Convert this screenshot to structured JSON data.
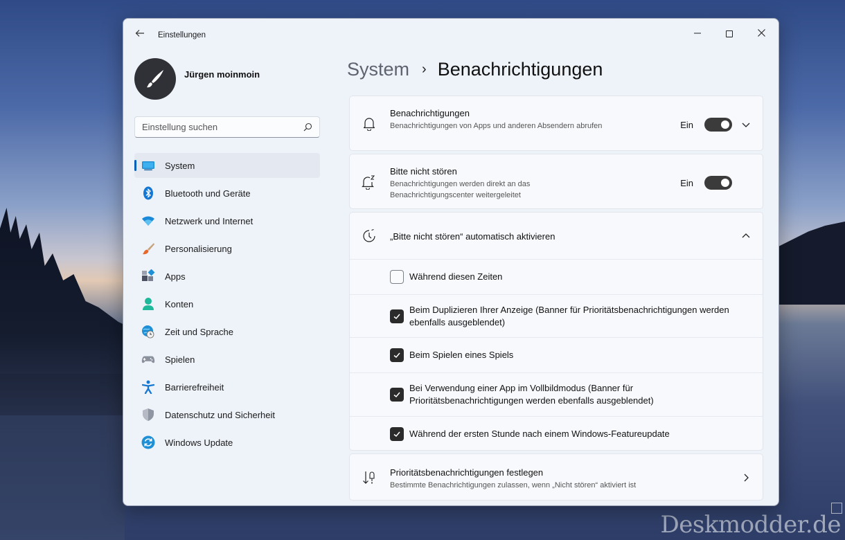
{
  "window": {
    "app_title": "Einstellungen"
  },
  "user": {
    "name": "Jürgen moinmoin"
  },
  "search": {
    "placeholder": "Einstellung suchen"
  },
  "sidebar": {
    "items": [
      {
        "label": "System",
        "icon": "system-icon",
        "active": true
      },
      {
        "label": "Bluetooth und Geräte",
        "icon": "bluetooth-icon"
      },
      {
        "label": "Netzwerk und Internet",
        "icon": "wifi-icon"
      },
      {
        "label": "Personalisierung",
        "icon": "brush-icon"
      },
      {
        "label": "Apps",
        "icon": "apps-icon"
      },
      {
        "label": "Konten",
        "icon": "person-icon"
      },
      {
        "label": "Zeit und Sprache",
        "icon": "clock-globe-icon"
      },
      {
        "label": "Spielen",
        "icon": "gamepad-icon"
      },
      {
        "label": "Barrierefreiheit",
        "icon": "accessibility-icon"
      },
      {
        "label": "Datenschutz und Sicherheit",
        "icon": "shield-icon"
      },
      {
        "label": "Windows Update",
        "icon": "update-icon"
      }
    ]
  },
  "breadcrumb": {
    "parent": "System",
    "separator": "›",
    "current": "Benachrichtigungen"
  },
  "notifications": {
    "title": "Benachrichtigungen",
    "description": "Benachrichtigungen von Apps und anderen Absendern abrufen",
    "toggle_label": "Ein",
    "enabled": true
  },
  "dnd": {
    "title": "Bitte nicht stören",
    "description": "Benachrichtigungen werden direkt an das Benachrichtigungscenter weitergeleitet",
    "toggle_label": "Ein",
    "enabled": true
  },
  "auto_dnd": {
    "title": "„Bitte nicht stören“ automatisch aktivieren",
    "expanded": true,
    "options": [
      {
        "label": "Während diesen Zeiten",
        "checked": false
      },
      {
        "label": "Beim Duplizieren Ihrer Anzeige (Banner für Prioritätsbenachrichtigungen werden ebenfalls ausgeblendet)",
        "checked": true
      },
      {
        "label": "Beim Spielen eines Spiels",
        "checked": true
      },
      {
        "label": "Bei Verwendung einer App im Vollbildmodus (Banner für Prioritätsbenachrichtigungen werden ebenfalls ausgeblendet)",
        "checked": true
      },
      {
        "label": "Während der ersten Stunde nach einem Windows-Featureupdate",
        "checked": true
      }
    ]
  },
  "priority": {
    "title": "Prioritätsbenachrichtigungen festlegen",
    "description": "Bestimmte Benachrichtigungen zulassen, wenn „Nicht stören“ aktiviert ist"
  },
  "watermark": "Deskmodder.de",
  "colors": {
    "accent": "#005fb8",
    "toggle_on": "#3b3b3b",
    "window_bg": "#eef2f9",
    "card_bg": "#f8f9fc"
  }
}
